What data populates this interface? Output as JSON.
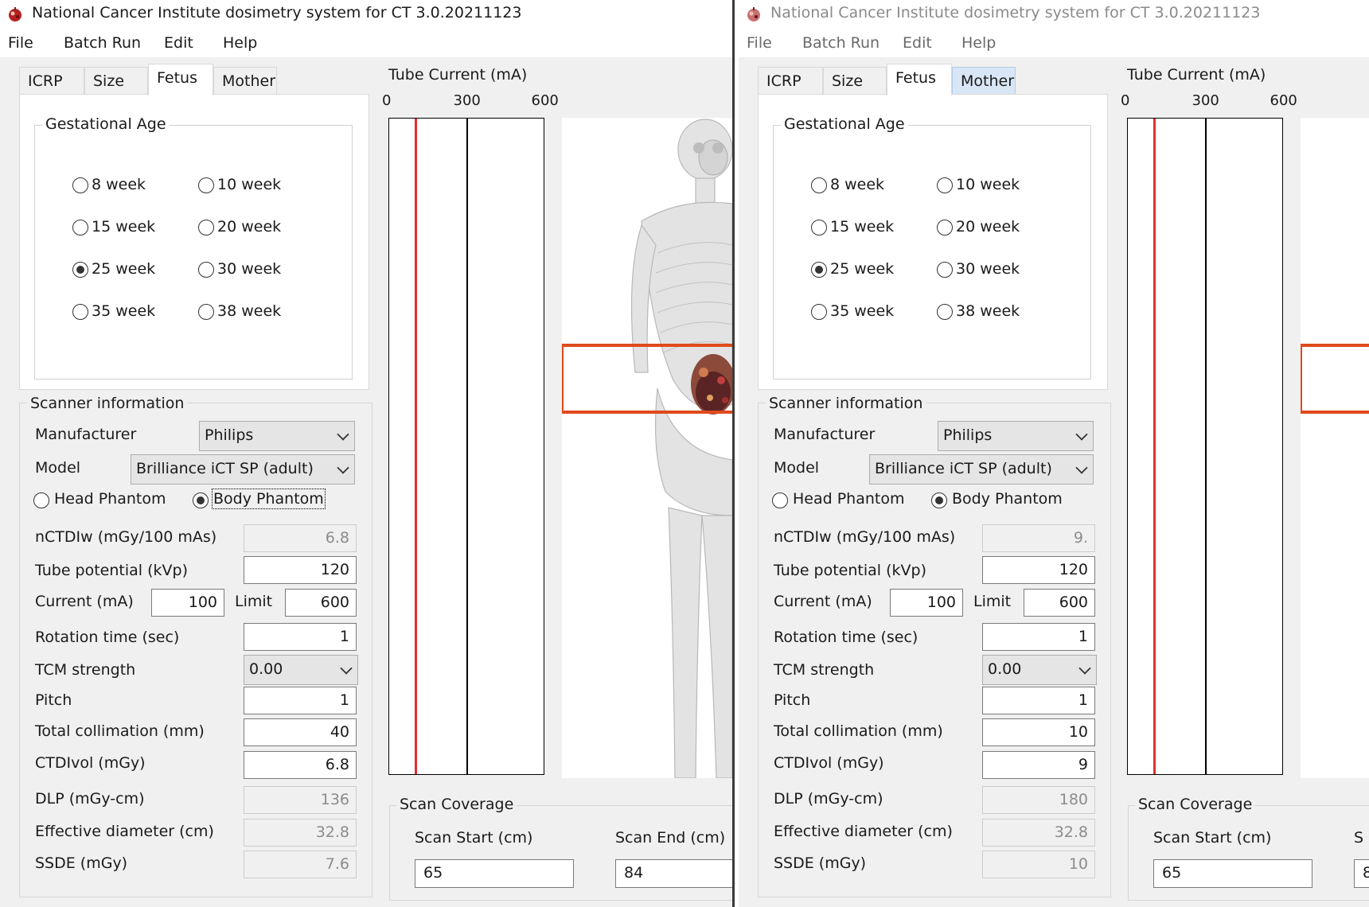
{
  "windows": [
    {
      "id": "left",
      "active": true,
      "title": "National Cancer Institute dosimetry system for CT 3.0.20211123",
      "menu": [
        "File",
        "Batch Run",
        "Edit",
        "Help"
      ],
      "tabs": [
        "ICRP",
        "Size",
        "Fetus",
        "Mother"
      ],
      "active_tab": "Fetus",
      "gestational_age": {
        "title": "Gestational Age",
        "options": [
          "8 week",
          "10 week",
          "15 week",
          "20 week",
          "25 week",
          "30 week",
          "35 week",
          "38 week"
        ],
        "selected": "25 week"
      },
      "scanner": {
        "title": "Scanner information",
        "manufacturer_label": "Manufacturer",
        "manufacturer": "Philips",
        "model_label": "Model",
        "model": "Brilliance iCT SP (adult)",
        "head_phantom": "Head Phantom",
        "body_phantom": "Body Phantom",
        "phantom_selected": "Body Phantom",
        "nctdiw_label": "nCTDIw (mGy/100 mAs)",
        "nctdiw": "6.8",
        "kvp_label": "Tube potential (kVp)",
        "kvp": "120",
        "current_label": "Current (mA)",
        "current": "100",
        "limit_label": "Limit",
        "limit": "600",
        "rotation_label": "Rotation time (sec)",
        "rotation": "1",
        "tcm_label": "TCM strength",
        "tcm": "0.00",
        "pitch_label": "Pitch",
        "pitch": "1",
        "collimation_label": "Total collimation (mm)",
        "collimation": "40",
        "ctdivol_label": "CTDIvol (mGy)",
        "ctdivol": "6.8",
        "dlp_label": "DLP (mGy-cm)",
        "dlp": "136",
        "eff_diam_label": "Effective diameter (cm)",
        "eff_diam": "32.8",
        "ssde_label": "SSDE (mGy)",
        "ssde": "7.6"
      },
      "tube_current": {
        "title": "Tube Current (mA)",
        "ticks": [
          "0",
          "300",
          "600"
        ],
        "max": 600,
        "value": 100,
        "line_color": "#e03030"
      },
      "coverage": {
        "title": "Scan Coverage",
        "start_label": "Scan Start (cm)",
        "start": "65",
        "end_label": "Scan End (cm)",
        "end": "84"
      }
    },
    {
      "id": "right",
      "active": false,
      "title": "National Cancer Institute dosimetry system for CT 3.0.20211123",
      "menu": [
        "File",
        "Batch Run",
        "Edit",
        "Help"
      ],
      "tabs": [
        "ICRP",
        "Size",
        "Fetus",
        "Mother"
      ],
      "active_tab": "Fetus",
      "hover_tab": "Mother",
      "gestational_age": {
        "title": "Gestational Age",
        "options": [
          "8 week",
          "10 week",
          "15 week",
          "20 week",
          "25 week",
          "30 week",
          "35 week",
          "38 week"
        ],
        "selected": "25 week"
      },
      "scanner": {
        "title": "Scanner information",
        "manufacturer_label": "Manufacturer",
        "manufacturer": "Philips",
        "model_label": "Model",
        "model": "Brilliance iCT SP (adult)",
        "head_phantom": "Head Phantom",
        "body_phantom": "Body Phantom",
        "phantom_selected": "Body Phantom",
        "nctdiw_label": "nCTDIw (mGy/100 mAs)",
        "nctdiw": "9.",
        "kvp_label": "Tube potential (kVp)",
        "kvp": "120",
        "current_label": "Current (mA)",
        "current": "100",
        "limit_label": "Limit",
        "limit": "600",
        "rotation_label": "Rotation time (sec)",
        "rotation": "1",
        "tcm_label": "TCM strength",
        "tcm": "0.00",
        "pitch_label": "Pitch",
        "pitch": "1",
        "collimation_label": "Total collimation (mm)",
        "collimation": "10",
        "ctdivol_label": "CTDIvol (mGy)",
        "ctdivol": "9",
        "dlp_label": "DLP (mGy-cm)",
        "dlp": "180",
        "eff_diam_label": "Effective diameter (cm)",
        "eff_diam": "32.8",
        "ssde_label": "SSDE (mGy)",
        "ssde": "10"
      },
      "tube_current": {
        "title": "Tube Current (mA)",
        "ticks": [
          "0",
          "300",
          "600"
        ],
        "max": 600,
        "value": 100,
        "line_color": "#e03030"
      },
      "coverage": {
        "title": "Scan Coverage",
        "start_label": "Scan Start (cm)",
        "start": "65",
        "end_label": "S",
        "end": "8"
      }
    }
  ],
  "colors": {
    "scan_range_box": "#e04a1c",
    "tube_current_line": "#e03030",
    "hover_tab": "#d8e6f5"
  },
  "icons": {
    "app": "nci-dosimetry-app-icon",
    "phantom": "body-phantom-skeleton"
  }
}
